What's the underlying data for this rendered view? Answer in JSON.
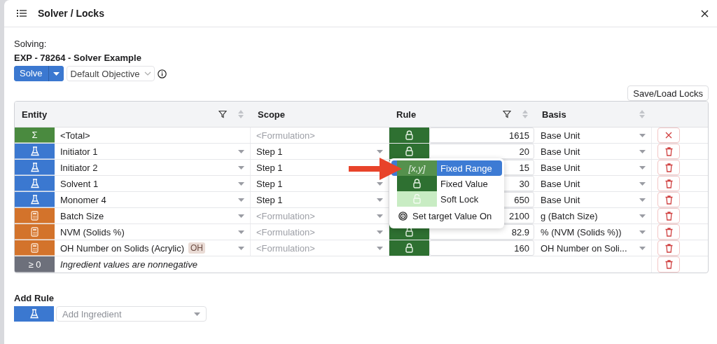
{
  "window": {
    "title": "Solver / Locks"
  },
  "solving": {
    "label": "Solving:",
    "name": "EXP - 78264 - Solver Example"
  },
  "solve_button": "Solve",
  "objective": "Default Objective",
  "save_load_button": "Save/Load Locks",
  "table": {
    "columns": [
      {
        "label": "Entity",
        "filter": true,
        "sort": true
      },
      {
        "label": "Scope",
        "filter": false,
        "sort": false
      },
      {
        "label": "Rule",
        "filter": true,
        "sort": true
      },
      {
        "label": "Basis",
        "filter": false,
        "sort": true
      }
    ],
    "rows": [
      {
        "kind": "total",
        "symbol": "Σ",
        "entity": "<Total>",
        "entity_dropdown": false,
        "scope": "<Formulation>",
        "scope_muted": true,
        "scope_dropdown": false,
        "lock_visible": true,
        "value": "1615",
        "basis": "Base Unit",
        "clearable": true
      },
      {
        "kind": "ingredient",
        "entity": "Initiator 1",
        "entity_dropdown": true,
        "scope": "Step 1",
        "scope_muted": false,
        "scope_dropdown": true,
        "lock_visible": true,
        "value": "20",
        "basis": "Base Unit",
        "clearable": false
      },
      {
        "kind": "ingredient",
        "entity": "Initiator 2",
        "entity_dropdown": true,
        "scope": "Step 1",
        "scope_muted": false,
        "scope_dropdown": false,
        "lock_visible": false,
        "value": "15",
        "basis": "Base Unit",
        "clearable": false
      },
      {
        "kind": "ingredient",
        "entity": "Solvent 1",
        "entity_dropdown": true,
        "scope": "Step 1",
        "scope_muted": false,
        "scope_dropdown": true,
        "lock_visible": false,
        "value": "30",
        "basis": "Base Unit",
        "clearable": false
      },
      {
        "kind": "ingredient",
        "entity": "Monomer 4",
        "entity_dropdown": true,
        "scope": "Step 1",
        "scope_muted": false,
        "scope_dropdown": true,
        "lock_visible": false,
        "value": "650",
        "basis": "Base Unit",
        "clearable": false
      },
      {
        "kind": "calculation",
        "entity": "Batch Size",
        "entity_dropdown": true,
        "scope": "<Formulation>",
        "scope_muted": true,
        "scope_dropdown": true,
        "lock_visible": false,
        "value": "2100",
        "basis": "g (Batch Size)",
        "clearable": false
      },
      {
        "kind": "calculation",
        "entity": "NVM (Solids %)",
        "entity_dropdown": true,
        "scope": "<Formulation>",
        "scope_muted": true,
        "scope_dropdown": true,
        "lock_visible": true,
        "value": "82.9",
        "basis": "% (NVM (Solids %))",
        "clearable": false
      },
      {
        "kind": "calculation",
        "entity": "OH Number on Solids (Acrylic)",
        "tag": "OH",
        "entity_dropdown": true,
        "scope": "<Formulation>",
        "scope_muted": true,
        "scope_dropdown": true,
        "lock_visible": true,
        "value": "160",
        "basis": "OH Number on Soli...",
        "clearable": false
      },
      {
        "kind": "constraint",
        "symbol": "≥ 0",
        "entity": "Ingredient values are nonnegative",
        "clearable": false
      }
    ]
  },
  "rule_menu": {
    "items": [
      {
        "kind": "range",
        "symbol": "[x,y]",
        "label": "Fixed Range",
        "selected": true
      },
      {
        "kind": "fixed",
        "label": "Fixed Value",
        "selected": false
      },
      {
        "kind": "soft",
        "label": "Soft Lock",
        "selected": false
      },
      {
        "kind": "target",
        "label": "Set target Value On",
        "selected": false
      }
    ]
  },
  "add_rule": {
    "title": "Add Rule",
    "placeholder": "Add Ingredient"
  }
}
